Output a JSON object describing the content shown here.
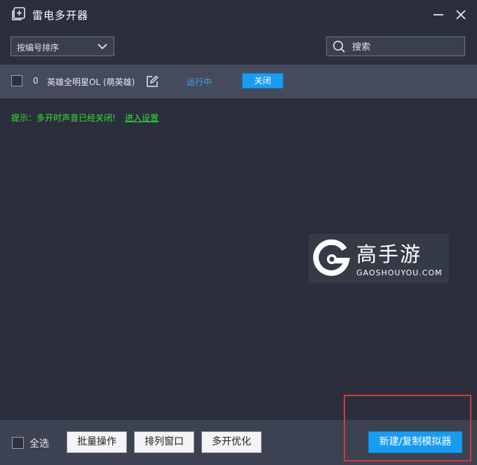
{
  "window": {
    "title": "雷电多开器"
  },
  "toolbar": {
    "sort_label": "按编号排序",
    "search_placeholder": "搜索"
  },
  "instances": [
    {
      "index": "0",
      "name": "英雄全明星OL (萌英雄)",
      "status": "运行中",
      "action": "关闭"
    }
  ],
  "hint": {
    "text": "提示：多开时声音已经关闭!",
    "link": "进入设置"
  },
  "watermark": {
    "title": "高手游",
    "subtitle": "GAOSHOUYOU.COM"
  },
  "footer": {
    "select_all": "全选",
    "batch": "批量操作",
    "arrange": "排列窗口",
    "optimize": "多开优化",
    "new_copy": "新建/复制模拟器"
  },
  "colors": {
    "accent": "#189cf1",
    "hint": "#35e033",
    "status": "#3da8ea",
    "highlight": "#d23a3a"
  }
}
